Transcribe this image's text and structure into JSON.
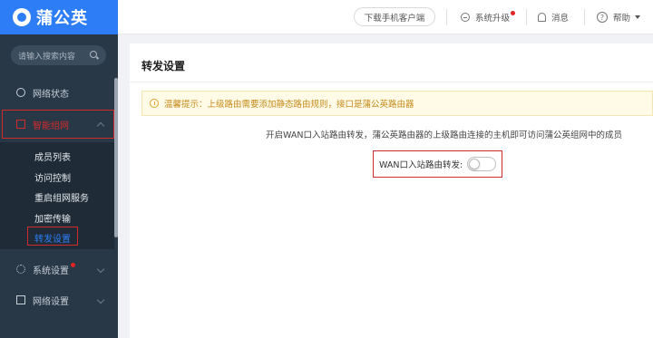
{
  "brand": {
    "name": "蒲公英",
    "accent": "#2d7df6"
  },
  "sidebar": {
    "search_placeholder": "请输入搜索内容",
    "items": [
      {
        "label": "网络状态",
        "icon": "globe-icon"
      },
      {
        "label": "智能组网",
        "icon": "mesh-icon",
        "expanded": true
      },
      {
        "label": "系统设置",
        "icon": "cog-icon",
        "badge": "red-dot"
      },
      {
        "label": "网络设置",
        "icon": "list-icon"
      }
    ],
    "submenu": [
      "成员列表",
      "访问控制",
      "重启组网服务",
      "加密传输",
      "转发设置"
    ],
    "current_submenu": "转发设置"
  },
  "topbar": {
    "download": "下载手机客户端",
    "upgrade": "系统升级",
    "messages": "消息",
    "help": "帮助"
  },
  "main": {
    "title": "转发设置",
    "alert": "温馨提示：上级路由需要添加静态路由规则，接口是蒲公英路由器",
    "description": "开启WAN口入站路由转发，蒲公英路由器的上级路由连接的主机即可访问蒲公英组网中的成员",
    "toggle_label": "WAN口入站路由转发:",
    "toggle_on": false
  },
  "colors": {
    "highlight": "#d12a2a",
    "sidebar_bg": "#293847",
    "warning_text": "#c58a1b"
  }
}
